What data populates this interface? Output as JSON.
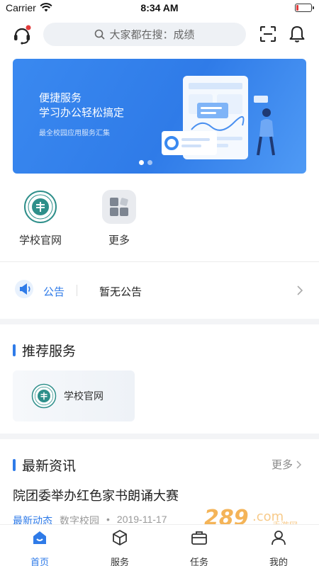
{
  "status_bar": {
    "carrier": "Carrier",
    "time": "8:34 AM"
  },
  "header": {
    "search_placeholder": "大家都在搜：成绩",
    "icons": [
      "customer-service-icon",
      "search-icon",
      "scan-icon",
      "bell-icon"
    ]
  },
  "banner": {
    "line1": "便捷服务",
    "line2": "学习办公轻松搞定",
    "line3": "最全校园应用服务汇集",
    "slide_count": 2,
    "active_slide": 0
  },
  "quick_apps": [
    {
      "label": "学校官网",
      "icon": "school-logo-icon"
    },
    {
      "label": "更多",
      "icon": "more-apps-icon"
    }
  ],
  "notice": {
    "tag": "公告",
    "text": "暂无公告"
  },
  "recommended": {
    "title": "推荐服务",
    "items": [
      {
        "label": "学校官网",
        "icon": "school-logo-icon"
      }
    ]
  },
  "news": {
    "title": "最新资讯",
    "more_label": "更多",
    "items": [
      {
        "title": "院团委举办红色家书朗诵大赛",
        "category": "最新动态",
        "source": "数字校园",
        "dot": "•",
        "date": "2019-11-17"
      }
    ]
  },
  "watermark": {
    "text": "289.com",
    "sub": "手游网"
  },
  "tabbar": {
    "active": 0,
    "tabs": [
      {
        "label": "首页",
        "icon": "home-icon"
      },
      {
        "label": "服务",
        "icon": "service-cube-icon"
      },
      {
        "label": "任务",
        "icon": "briefcase-icon"
      },
      {
        "label": "我的",
        "icon": "user-icon"
      }
    ]
  },
  "colors": {
    "accent": "#2f7be8",
    "banner_start": "#3a89f0",
    "badge": "#e23b3b"
  }
}
